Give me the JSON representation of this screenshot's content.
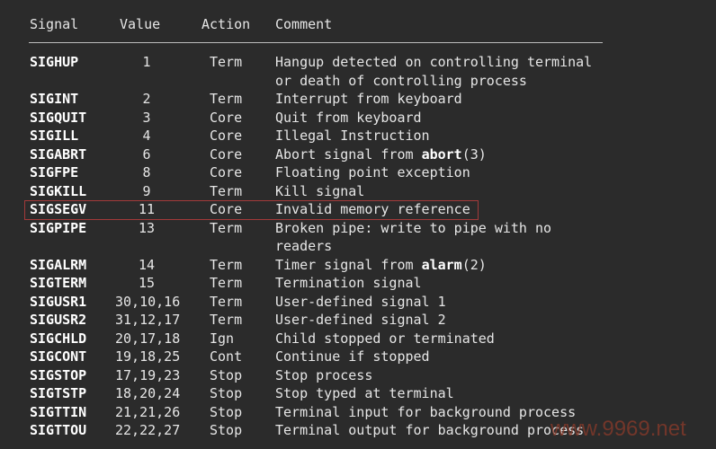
{
  "header": {
    "signal": "Signal",
    "value": "Value",
    "action": "Action",
    "comment": "Comment"
  },
  "rows": [
    {
      "signal": "SIGHUP",
      "value": "1",
      "action": "Term",
      "comment": [
        "Hangup detected on controlling terminal",
        "or death of controlling process"
      ]
    },
    {
      "signal": "SIGINT",
      "value": "2",
      "action": "Term",
      "comment": [
        "Interrupt from keyboard"
      ]
    },
    {
      "signal": "SIGQUIT",
      "value": "3",
      "action": "Core",
      "comment": [
        "Quit from keyboard"
      ]
    },
    {
      "signal": "SIGILL",
      "value": "4",
      "action": "Core",
      "comment": [
        "Illegal Instruction"
      ]
    },
    {
      "signal": "SIGABRT",
      "value": "6",
      "action": "Core",
      "comment": [
        "Abort signal from abort(3)"
      ]
    },
    {
      "signal": "SIGFPE",
      "value": "8",
      "action": "Core",
      "comment": [
        "Floating point exception"
      ]
    },
    {
      "signal": "SIGKILL",
      "value": "9",
      "action": "Term",
      "comment": [
        "Kill signal"
      ]
    },
    {
      "signal": "SIGSEGV",
      "value": "11",
      "action": "Core",
      "comment": [
        "Invalid memory reference"
      ],
      "highlighted": true
    },
    {
      "signal": "SIGPIPE",
      "value": "13",
      "action": "Term",
      "comment": [
        "Broken pipe: write to pipe with no",
        "readers"
      ]
    },
    {
      "signal": "SIGALRM",
      "value": "14",
      "action": "Term",
      "comment": [
        "Timer signal from alarm(2)"
      ]
    },
    {
      "signal": "SIGTERM",
      "value": "15",
      "action": "Term",
      "comment": [
        "Termination signal"
      ]
    },
    {
      "signal": "SIGUSR1",
      "value": "30,10,16",
      "action": "Term",
      "comment": [
        "User-defined signal 1"
      ]
    },
    {
      "signal": "SIGUSR2",
      "value": "31,12,17",
      "action": "Term",
      "comment": [
        "User-defined signal 2"
      ]
    },
    {
      "signal": "SIGCHLD",
      "value": "20,17,18",
      "action": "Ign",
      "comment": [
        "Child stopped or terminated"
      ]
    },
    {
      "signal": "SIGCONT",
      "value": "19,18,25",
      "action": "Cont",
      "comment": [
        "Continue if stopped"
      ]
    },
    {
      "signal": "SIGSTOP",
      "value": "17,19,23",
      "action": "Stop",
      "comment": [
        "Stop process"
      ]
    },
    {
      "signal": "SIGTSTP",
      "value": "18,20,24",
      "action": "Stop",
      "comment": [
        "Stop typed at terminal"
      ]
    },
    {
      "signal": "SIGTTIN",
      "value": "21,21,26",
      "action": "Stop",
      "comment": [
        "Terminal input for background process"
      ]
    },
    {
      "signal": "SIGTTOU",
      "value": "22,22,27",
      "action": "Stop",
      "comment": [
        "Terminal output for background process"
      ]
    }
  ],
  "watermark": "www.9969.net",
  "highlight_color": "#a33a3a"
}
